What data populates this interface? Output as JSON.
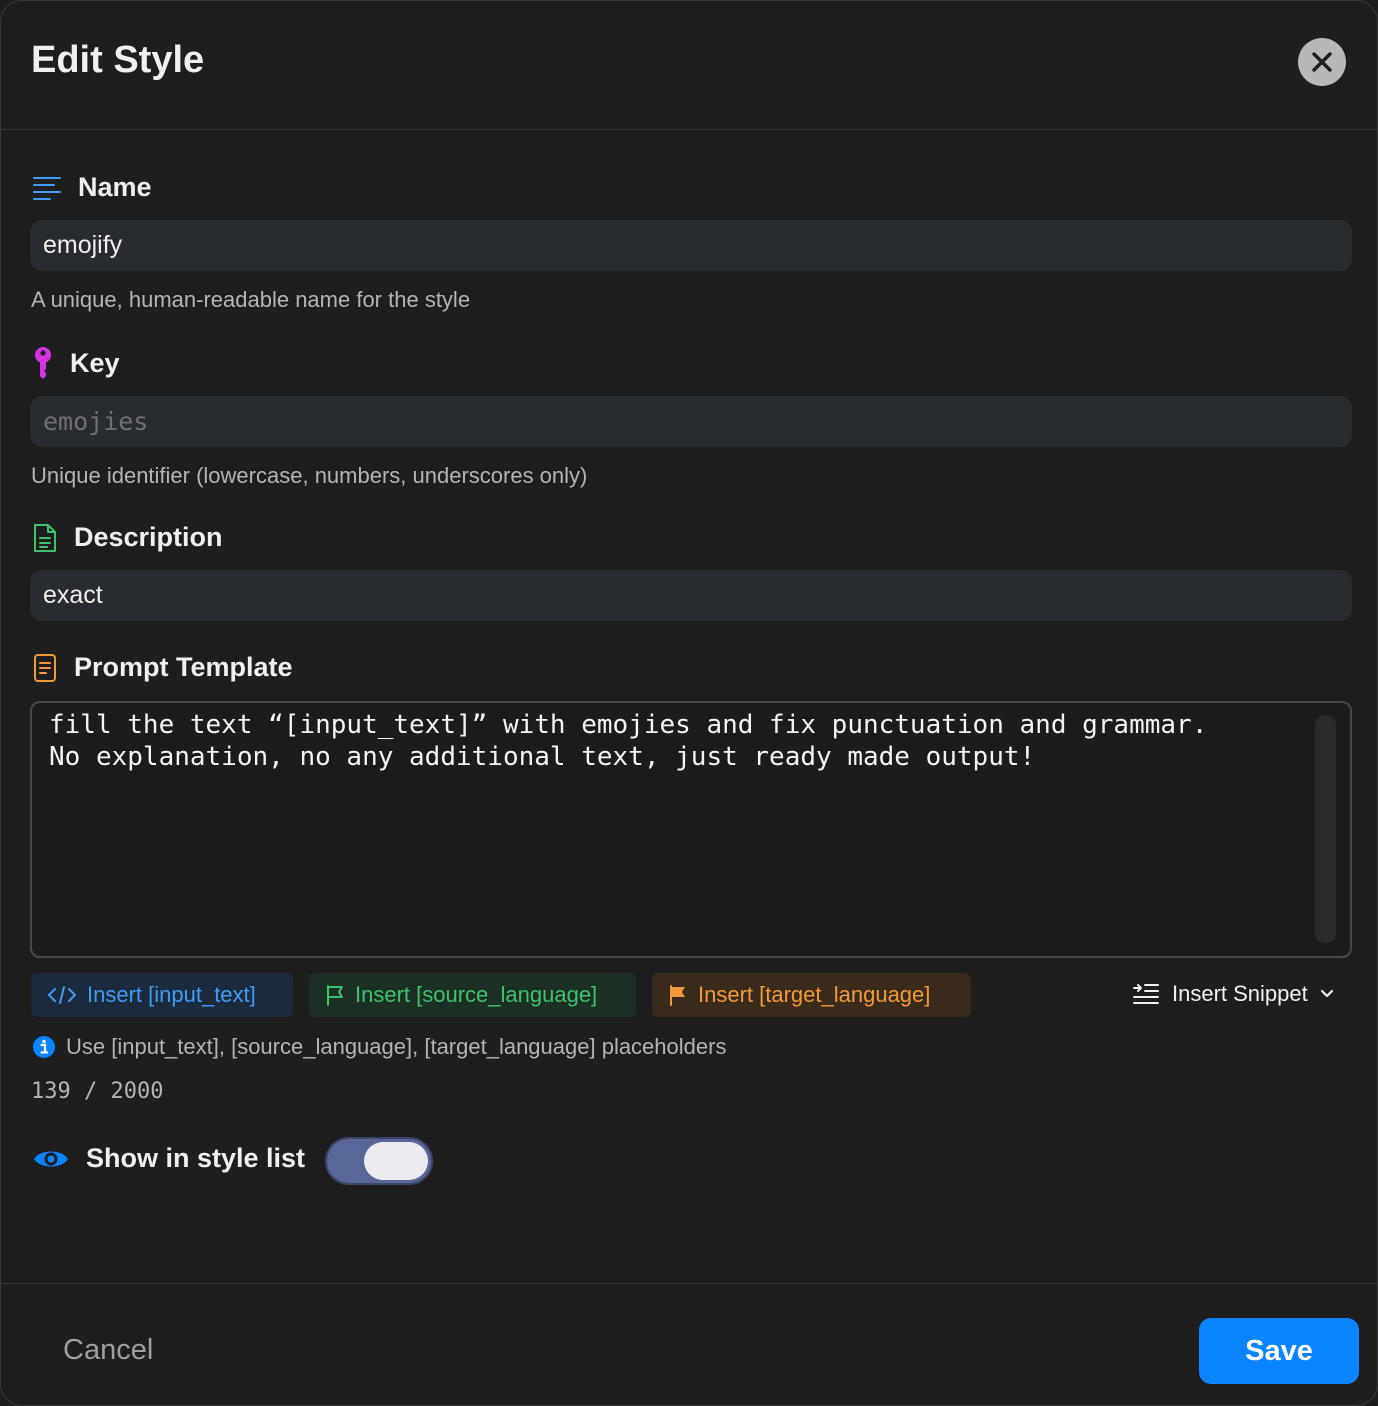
{
  "dialog": {
    "title": "Edit Style"
  },
  "name": {
    "label": "Name",
    "value": "emojify",
    "help": "A unique, human-readable name for the style",
    "icon": "lines-icon",
    "icon_color": "#3e9cf6"
  },
  "key": {
    "label": "Key",
    "placeholder": "emojies",
    "help": "Unique identifier (lowercase, numbers, underscores only)",
    "icon": "key-icon",
    "icon_color": "#d633e0"
  },
  "description": {
    "label": "Description",
    "value": "exact",
    "icon": "document-icon",
    "icon_color": "#3fc36a"
  },
  "prompt": {
    "label": "Prompt Template",
    "value": "fill the text “[input_text]” with emojies and fix punctuation and grammar.\nNo explanation, no any additional text, just ready made output!",
    "icon": "notes-icon",
    "icon_color": "#f29a3a"
  },
  "insert_buttons": {
    "input_text": "Insert [input_text]",
    "source_language": "Insert [source_language]",
    "target_language": "Insert [target_language]",
    "snippet": "Insert Snippet"
  },
  "info": "Use [input_text], [source_language], [target_language] placeholders",
  "counter": "139 / 2000",
  "visibility": {
    "label": "Show in style list",
    "enabled": true
  },
  "footer": {
    "cancel": "Cancel",
    "save": "Save"
  }
}
